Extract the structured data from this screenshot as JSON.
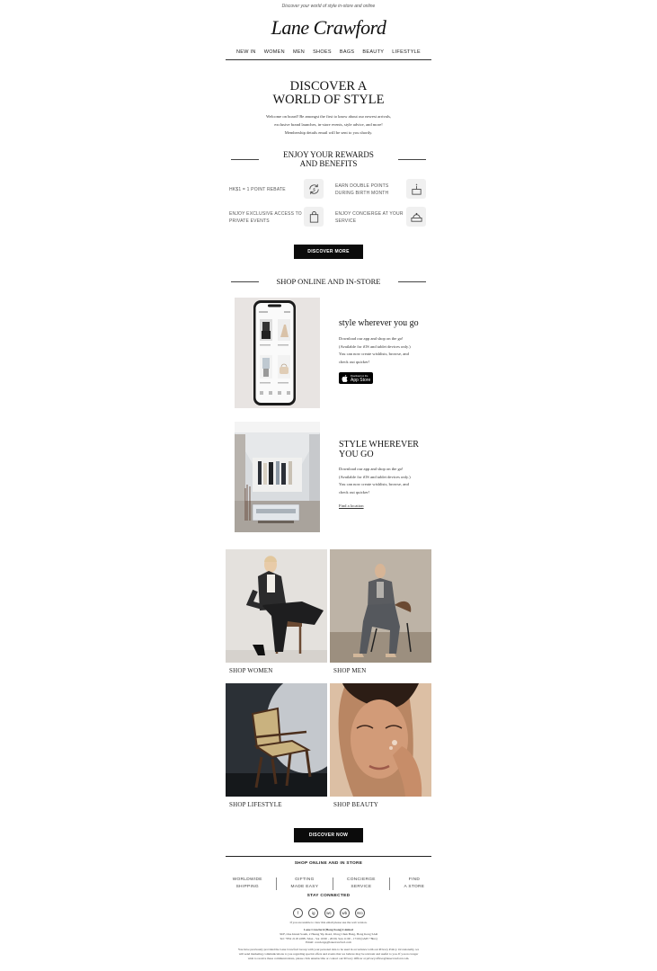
{
  "header": {
    "preheader": "Discover your world of style in-store and online",
    "logo": "Lane Crawford",
    "nav": [
      "NEW IN",
      "WOMEN",
      "MEN",
      "SHOES",
      "BAGS",
      "BEAUTY",
      "LIFESTYLE"
    ]
  },
  "hero": {
    "title_line1": "DISCOVER A",
    "title_line2": "WORLD OF STYLE",
    "body_line1": "Welcome on board! Be amongst the first to know about our newest arrivals,",
    "body_line2": "exclusive brand launches, in-store events, style advice, and more!",
    "body_line3": "Membership details email will be sent to you shortly."
  },
  "rewards": {
    "title_line1": "ENJOY YOUR REWARDS",
    "title_line2": "AND BENEFITS",
    "items": [
      {
        "text": "HK$1 = 1 POINT REBATE",
        "icon": "rebate-icon"
      },
      {
        "text_line1": "EARN DOUBLE POINTS",
        "text_line2": "DURING BIRTH MONTH",
        "icon": "cake-icon"
      },
      {
        "text_line1": "ENJOY EXCLUSIVE ACCESS TO",
        "text_line2": "PRIVATE EVENTS",
        "icon": "shopping-bag-icon"
      },
      {
        "text_line1": "ENJOY CONCIERGE AT YOUR",
        "text_line2": "SERVICE",
        "icon": "concierge-icon"
      }
    ],
    "button": "DISCOVER MORE"
  },
  "shop": {
    "title": "SHOP ONLINE AND IN-STORE",
    "app_promo": {
      "title": "style wherever you go",
      "body_line1": "Download our app and shop on the go!",
      "body_line2": "(Available for iOS and tablet devices only.)",
      "body_line3": "You can now create wishlists, browse, and",
      "body_line4": "check out quicker!",
      "badge_small": "Download on the",
      "badge_big": "App Store"
    },
    "store_promo": {
      "title_line1": "STYLE WHEREVER",
      "title_line2": "YOU GO",
      "body_line1": "Download our app and shop on the go!",
      "body_line2": "(Available for iOS and tablet devices only.)",
      "body_line3": "You can now create wishlists, browse, and",
      "body_line4": "check out quicker!",
      "link": "Find a location"
    }
  },
  "categories": [
    {
      "label": "SHOP WOMEN"
    },
    {
      "label": "SHOP MEN"
    },
    {
      "label": "SHOP LIFESTYLE"
    },
    {
      "label": "SHOP BEAUTY"
    }
  ],
  "cta": "DISCOVER NOW",
  "footer": {
    "title": "SHOP ONLINE AND IN STORE",
    "links": [
      {
        "line1": "WORLDWIDE",
        "line2": "SHIPPING"
      },
      {
        "line1": "GIFTING",
        "line2": "MADE EASY"
      },
      {
        "line1": "CONCIERGE",
        "line2": "SERVICE"
      },
      {
        "line1": "FIND",
        "line2": "A STORE"
      }
    ],
    "stay_connected": "STAY CONNECTED",
    "socials": [
      "f",
      "ig",
      "wc",
      "wb",
      "RED"
    ],
    "view_online": "If you are unable to view this email please use the web version.",
    "company": "Lane Crawford (Hong Kong) Limited",
    "address": "30/F, One Island South, 2 Heung Yip Road, Wong Chuk Hang, Hong Kong SAR",
    "phone": "Tel: +852 2118 2288 | Mon - Sat 10:00 - 20:00, Sun 11:00 - 17:00 (GMT +8hrs)",
    "email": "Email: concierge@lanecrawford.com",
    "legal1": "You have previously provided the Lane Crawford Group with your personal data to be used in accordance with our Privacy Policy. Occasionally, we",
    "legal2": "will send marketing communications to you regarding special offers and events that we believe may be relevant and useful to you. If you no longer",
    "legal3": "wish to receive these communications, please click unsubscribe or contact our Privacy Officer at privacyofficer@lanecrawford.com."
  },
  "colors": {
    "button_bg": "#0b0b0b",
    "text": "#222222",
    "rule": "#444444"
  }
}
